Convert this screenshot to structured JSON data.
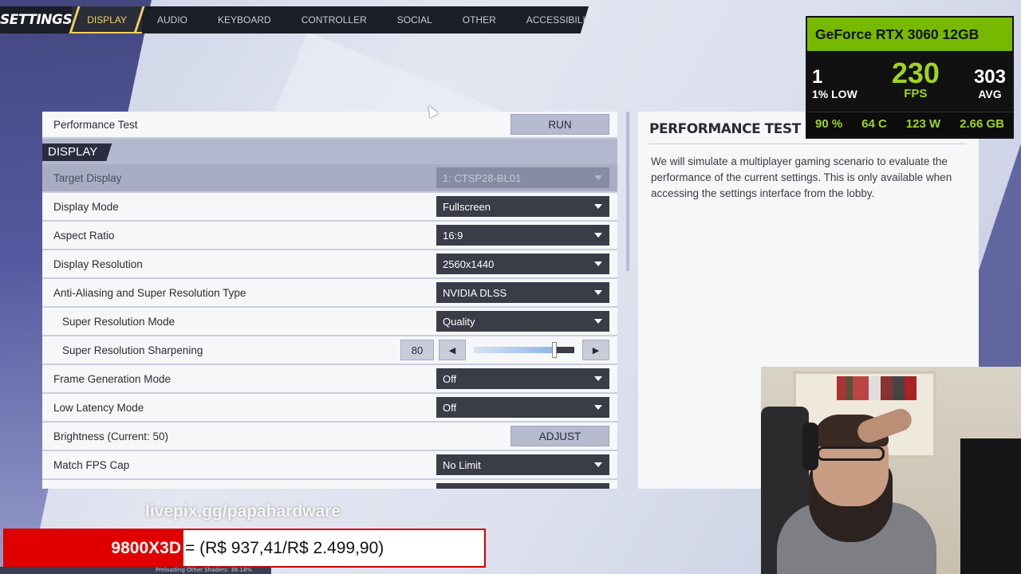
{
  "nav": {
    "title": "SETTINGS",
    "tabs": [
      "DISPLAY",
      "AUDIO",
      "KEYBOARD",
      "CONTROLLER",
      "SOCIAL",
      "OTHER",
      "ACCESSIBILITY"
    ],
    "active_tab": "DISPLAY"
  },
  "settings": {
    "performance_test_label": "Performance Test",
    "run_label": "RUN",
    "section_header": "DISPLAY",
    "rows": {
      "target_display": {
        "label": "Target Display",
        "value": "1: CTSP28-BL01"
      },
      "display_mode": {
        "label": "Display Mode",
        "value": "Fullscreen"
      },
      "aspect_ratio": {
        "label": "Aspect Ratio",
        "value": "16:9"
      },
      "display_resolution": {
        "label": "Display Resolution",
        "value": "2560x1440"
      },
      "anti_aliasing": {
        "label": "Anti-Aliasing and Super Resolution Type",
        "value": "NVIDIA DLSS"
      },
      "super_resolution_mode": {
        "label": "Super Resolution Mode",
        "value": "Quality"
      },
      "super_resolution_sharpening": {
        "label": "Super Resolution Sharpening",
        "value": "80",
        "level": 0.8
      },
      "frame_generation": {
        "label": "Frame Generation Mode",
        "value": "Off"
      },
      "low_latency": {
        "label": "Low Latency Mode",
        "value": "Off"
      },
      "brightness": {
        "label": "Brightness (Current: 50)",
        "button": "ADJUST"
      },
      "match_fps_cap": {
        "label": "Match FPS Cap",
        "value": "No Limit"
      }
    }
  },
  "info": {
    "title": "PERFORMANCE TEST",
    "text": "We will simulate a multiplayer gaming scenario to evaluate the performance of the current settings. This is only available when accessing the settings interface from the lobby."
  },
  "gpu_overlay": {
    "gpu_name": "GeForce RTX 3060 12GB",
    "low_value": "1",
    "low_label": "1% LOW",
    "fps_value": "230",
    "fps_label": "FPS",
    "avg_value": "303",
    "avg_label": "AVG",
    "usage": "90 %",
    "temp": "64 C",
    "power": "123 W",
    "vram": "2.66 GB",
    "accent_color": "#76b900"
  },
  "stream_overlay": {
    "livepix": "livepix.gg/papahardware",
    "price_product": "9800X3D",
    "price_text": "= (R$ 937,41/R$ 2.499,90)",
    "footer_text": "Preloading Other Shaders: 38.18%"
  },
  "icons": {
    "caret": "chevron-down-icon",
    "left": "arrow-left-icon",
    "right": "arrow-right-icon"
  }
}
